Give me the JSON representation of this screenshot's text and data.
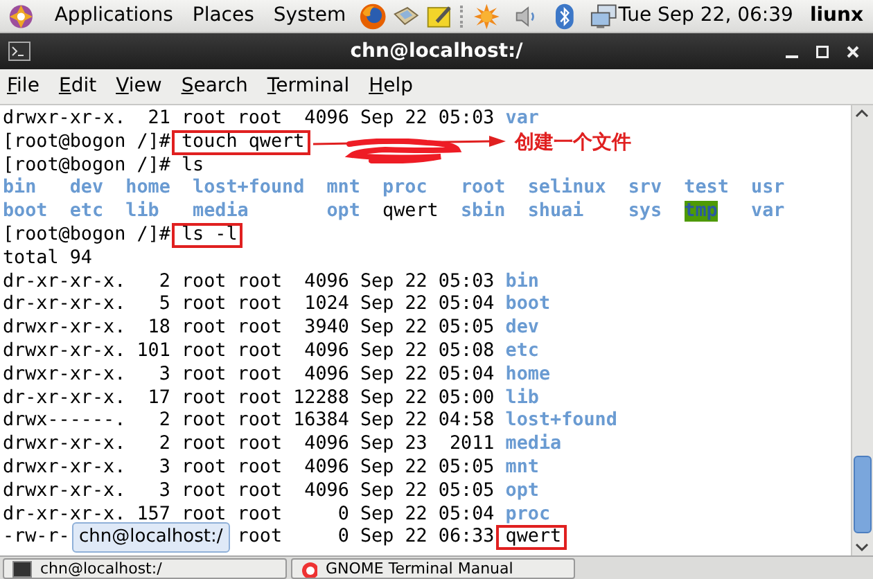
{
  "top_panel": {
    "menus": [
      "Applications",
      "Places",
      "System"
    ],
    "clock": "Tue Sep 22, 06:39",
    "user": "liunx"
  },
  "window": {
    "title": "chn@localhost:/"
  },
  "menu_bar": [
    "File",
    "Edit",
    "View",
    "Search",
    "Terminal",
    "Help"
  ],
  "terminal_lines": [
    {
      "kind": "text",
      "segments": [
        {
          "text": "drwxr-xr-x.  21 root root  4096 Sep 22 05:03 ",
          "kind": "text",
          "boxed": false
        },
        {
          "text": "var",
          "kind": "directory",
          "boxed": false
        }
      ]
    },
    {
      "kind": "text",
      "segments": [
        {
          "text": "[root@bogon /]# ",
          "kind": "text",
          "boxed": false
        },
        {
          "text": "touch qwert",
          "kind": "text",
          "boxed": true,
          "callout": "创建一个文件"
        }
      ]
    },
    {
      "kind": "text",
      "segments": [
        {
          "text": "[root@bogon /]# ls",
          "kind": "text",
          "boxed": false
        }
      ]
    },
    {
      "kind": "ls_row",
      "entries": [
        {
          "name": "bin",
          "kind": "directory"
        },
        {
          "name": "dev",
          "kind": "directory"
        },
        {
          "name": "home",
          "kind": "directory"
        },
        {
          "name": "lost+found",
          "kind": "directory"
        },
        {
          "name": "mnt",
          "kind": "directory"
        },
        {
          "name": "proc",
          "kind": "directory"
        },
        {
          "name": "root",
          "kind": "directory"
        },
        {
          "name": "selinux",
          "kind": "directory"
        },
        {
          "name": "srv",
          "kind": "directory"
        },
        {
          "name": "test",
          "kind": "directory"
        },
        {
          "name": "usr",
          "kind": "directory"
        }
      ]
    },
    {
      "kind": "ls_row",
      "entries": [
        {
          "name": "boot",
          "kind": "directory"
        },
        {
          "name": "etc",
          "kind": "directory"
        },
        {
          "name": "lib",
          "kind": "directory"
        },
        {
          "name": "media",
          "kind": "directory"
        },
        {
          "name": "opt",
          "kind": "directory"
        },
        {
          "name": "qwert",
          "kind": "text"
        },
        {
          "name": "sbin",
          "kind": "directory"
        },
        {
          "name": "shuai",
          "kind": "directory"
        },
        {
          "name": "sys",
          "kind": "directory"
        },
        {
          "name": "tmp",
          "kind": "highlighted"
        },
        {
          "name": "var",
          "kind": "directory"
        }
      ]
    },
    {
      "kind": "text",
      "segments": [
        {
          "text": "[root@bogon /]# ",
          "kind": "text",
          "boxed": false
        },
        {
          "text": "ls -l",
          "kind": "text",
          "boxed": true
        }
      ]
    },
    {
      "kind": "text",
      "segments": [
        {
          "text": "total 94",
          "kind": "text",
          "boxed": false
        }
      ]
    },
    {
      "kind": "text",
      "segments": [
        {
          "text": "dr-xr-xr-x.   2 root root  4096 Sep 22 05:03 ",
          "kind": "text",
          "boxed": false
        },
        {
          "text": "bin",
          "kind": "directory",
          "boxed": false
        }
      ]
    },
    {
      "kind": "text",
      "segments": [
        {
          "text": "dr-xr-xr-x.   5 root root  1024 Sep 22 05:04 ",
          "kind": "text",
          "boxed": false
        },
        {
          "text": "boot",
          "kind": "directory",
          "boxed": false
        }
      ]
    },
    {
      "kind": "text",
      "segments": [
        {
          "text": "drwxr-xr-x.  18 root root  3940 Sep 22 05:05 ",
          "kind": "text",
          "boxed": false
        },
        {
          "text": "dev",
          "kind": "directory",
          "boxed": false
        }
      ]
    },
    {
      "kind": "text",
      "segments": [
        {
          "text": "drwxr-xr-x. 101 root root  4096 Sep 22 05:08 ",
          "kind": "text",
          "boxed": false
        },
        {
          "text": "etc",
          "kind": "directory",
          "boxed": false
        }
      ]
    },
    {
      "kind": "text",
      "segments": [
        {
          "text": "drwxr-xr-x.   3 root root  4096 Sep 22 05:04 ",
          "kind": "text",
          "boxed": false
        },
        {
          "text": "home",
          "kind": "directory",
          "boxed": false
        }
      ]
    },
    {
      "kind": "text",
      "segments": [
        {
          "text": "dr-xr-xr-x.  17 root root 12288 Sep 22 05:00 ",
          "kind": "text",
          "boxed": false
        },
        {
          "text": "lib",
          "kind": "directory",
          "boxed": false
        }
      ]
    },
    {
      "kind": "text",
      "segments": [
        {
          "text": "drwx------.   2 root root 16384 Sep 22 04:58 ",
          "kind": "text",
          "boxed": false
        },
        {
          "text": "lost+found",
          "kind": "directory",
          "boxed": false
        }
      ]
    },
    {
      "kind": "text",
      "segments": [
        {
          "text": "drwxr-xr-x.   2 root root  4096 Sep 23  2011 ",
          "kind": "text",
          "boxed": false
        },
        {
          "text": "media",
          "kind": "directory",
          "boxed": false
        }
      ]
    },
    {
      "kind": "text",
      "segments": [
        {
          "text": "drwxr-xr-x.   3 root root  4096 Sep 22 05:05 ",
          "kind": "text",
          "boxed": false
        },
        {
          "text": "mnt",
          "kind": "directory",
          "boxed": false
        }
      ]
    },
    {
      "kind": "text",
      "segments": [
        {
          "text": "drwxr-xr-x.   3 root root  4096 Sep 22 05:05 ",
          "kind": "text",
          "boxed": false
        },
        {
          "text": "opt",
          "kind": "directory",
          "boxed": false
        }
      ]
    },
    {
      "kind": "text",
      "segments": [
        {
          "text": "dr-xr-xr-x. 157 root root     0 Sep 22 05:04 ",
          "kind": "text",
          "boxed": false
        },
        {
          "text": "proc",
          "kind": "directory",
          "boxed": false
        }
      ]
    },
    {
      "kind": "covered",
      "before": "-rw-r-",
      "segments": [
        {
          "text": "root     0 Sep 22 06:33 ",
          "kind": "text",
          "boxed": false
        },
        {
          "text": "qwert",
          "kind": "text",
          "boxed": true
        }
      ]
    }
  ],
  "tooltip": {
    "text": "chn@localhost:/"
  },
  "taskbar": [
    {
      "label": "chn@localhost:/",
      "kind": "terminal"
    },
    {
      "label": "GNOME Terminal Manual",
      "kind": "help"
    }
  ]
}
